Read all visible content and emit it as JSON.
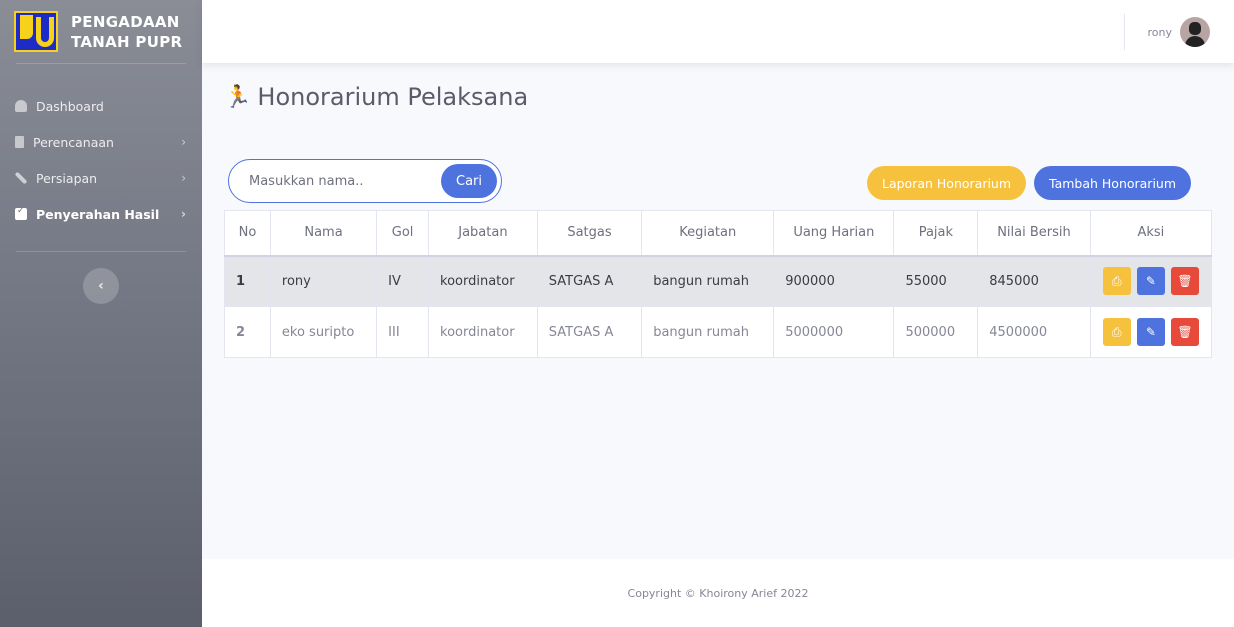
{
  "brand": {
    "line1": "PENGADAAN",
    "line2": "TANAH PUPR"
  },
  "sidebar": {
    "items": [
      {
        "label": "Dashboard",
        "icon": "gauge-icon",
        "has_submenu": false,
        "active": false
      },
      {
        "label": "Perencanaan",
        "icon": "clipboard-icon",
        "has_submenu": true,
        "active": false
      },
      {
        "label": "Persiapan",
        "icon": "wrench-icon",
        "has_submenu": true,
        "active": false
      },
      {
        "label": "Penyerahan Hasil",
        "icon": "calendar-check-icon",
        "has_submenu": true,
        "active": true
      }
    ],
    "toggle_icon": "chevron-left-icon"
  },
  "topbar": {
    "username": "rony"
  },
  "page": {
    "title": "Honorarium Pelaksana",
    "title_icon": "running-icon"
  },
  "search": {
    "placeholder": "Masukkan nama..",
    "value": "",
    "button": "Cari"
  },
  "actions": {
    "laporan": "Laporan Honorarium",
    "tambah": "Tambah Honorarium"
  },
  "table": {
    "headers": [
      "No",
      "Nama",
      "Gol",
      "Jabatan",
      "Satgas",
      "Kegiatan",
      "Uang Harian",
      "Pajak",
      "Nilai Bersih",
      "Aksi"
    ],
    "rows": [
      {
        "no": "1",
        "nama": "rony",
        "gol": "IV",
        "jabatan": "koordinator",
        "satgas": "SATGAS A",
        "kegiatan": "bangun rumah",
        "uang_harian": "900000",
        "pajak": "55000",
        "nilai_bersih": "845000"
      },
      {
        "no": "2",
        "nama": "eko suripto",
        "gol": "III",
        "jabatan": "koordinator",
        "satgas": "SATGAS A",
        "kegiatan": "bangun rumah",
        "uang_harian": "5000000",
        "pajak": "500000",
        "nilai_bersih": "4500000"
      }
    ]
  },
  "footer": {
    "text": "Copyright © Khoirony Arief 2022"
  },
  "colors": {
    "primary": "#4e73df",
    "warning": "#f6c23e",
    "danger": "#e74a3b"
  }
}
